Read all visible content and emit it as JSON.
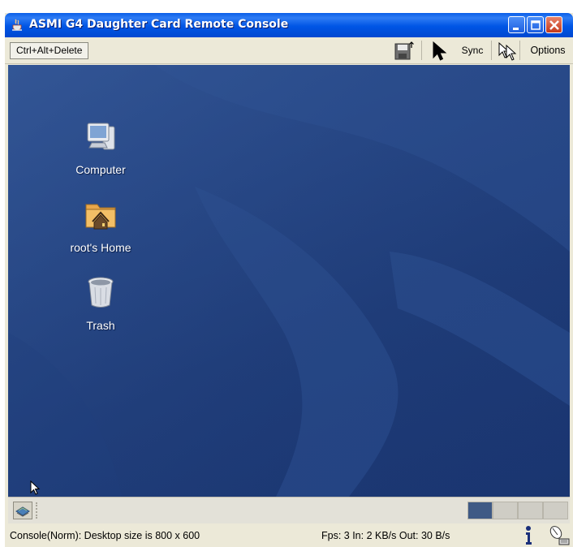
{
  "window": {
    "title": "ASMI G4 Daughter Card Remote Console"
  },
  "toolbar": {
    "ctrl_alt_delete_label": "Ctrl+Alt+Delete",
    "sync_label": "Sync",
    "options_label": "Options"
  },
  "desktop": {
    "icons": [
      {
        "label": "Computer",
        "icon": "computer-icon"
      },
      {
        "label": "root's Home",
        "icon": "home-folder-icon"
      },
      {
        "label": "Trash",
        "icon": "trash-icon"
      }
    ]
  },
  "statusbar": {
    "console_status": "Console(Norm): Desktop size is 800 x 600",
    "traffic": "Fps: 3 In: 2 KB/s Out: 30 B/s"
  },
  "colors": {
    "titlebar": "#0055e5",
    "desktop": "#22417f",
    "window_bg": "#ece9d8",
    "close_button": "#c4391b"
  }
}
